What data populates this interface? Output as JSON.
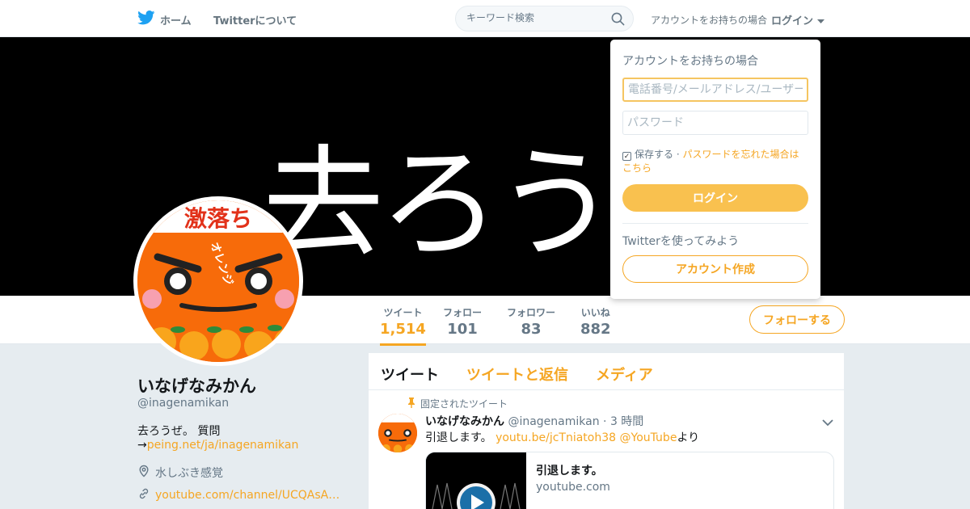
{
  "topbar": {
    "home_label": "ホーム",
    "about_label": "Twitterについて",
    "search_placeholder": "キーワード検索",
    "login_prompt": "アカウントをお持ちの場合",
    "login_link": "ログイン"
  },
  "banner": {
    "text": "去ろうぜ"
  },
  "profile_nav": {
    "stats": [
      {
        "label": "ツイート",
        "value": "1,514"
      },
      {
        "label": "フォロー",
        "value": "101"
      },
      {
        "label": "フォロワー",
        "value": "83"
      },
      {
        "label": "いいね",
        "value": "882"
      }
    ],
    "follow_button": "フォローする"
  },
  "profile": {
    "name": "いなげなみかん",
    "handle": "@inagenamikan",
    "bio_line1": "去ろうぜ。 質問",
    "bio_arrow": "→",
    "bio_link": "peing.net/ja/inagenamikan",
    "location": "水しぶき感覚",
    "url": "youtube.com/channel/UCQAsA…",
    "avatar_text": "激落ち",
    "avatar_label": "オレンジ"
  },
  "timeline": {
    "tabs": [
      "ツイート",
      "ツイートと返信",
      "メディア"
    ],
    "pinned_label": "固定されたツイート",
    "tweet": {
      "name": "いなげなみかん",
      "handle": "@inagenamikan",
      "time": "· 3 時間",
      "text_prefix": "引退します。 ",
      "link": "youtu.be/jcTniatoh38",
      "mention": "@YouTube",
      "text_suffix": "より",
      "card_title": "引退します。",
      "card_domain": "youtube.com"
    }
  },
  "login_dropdown": {
    "title": "アカウントをお持ちの場合",
    "username_placeholder": "電話番号/メールアドレス/ユーザー名",
    "password_placeholder": "パスワード",
    "remember_label": "保存する",
    "separator": "·",
    "forgot_link": "パスワードを忘れた場合はこちら",
    "login_button": "ログイン",
    "try_label": "Twitterを使ってみよう",
    "signup_button": "アカウント作成"
  },
  "colors": {
    "accent": "#f5a623",
    "login_button": "#f9c14f",
    "background": "#e6ecf0",
    "avatar_orange": "#f76b0a"
  },
  "icons": [
    "twitter-bird-icon",
    "search-icon",
    "caret-down-icon",
    "location-icon",
    "link-icon",
    "pin-icon",
    "chevron-down-icon",
    "play-icon"
  ]
}
